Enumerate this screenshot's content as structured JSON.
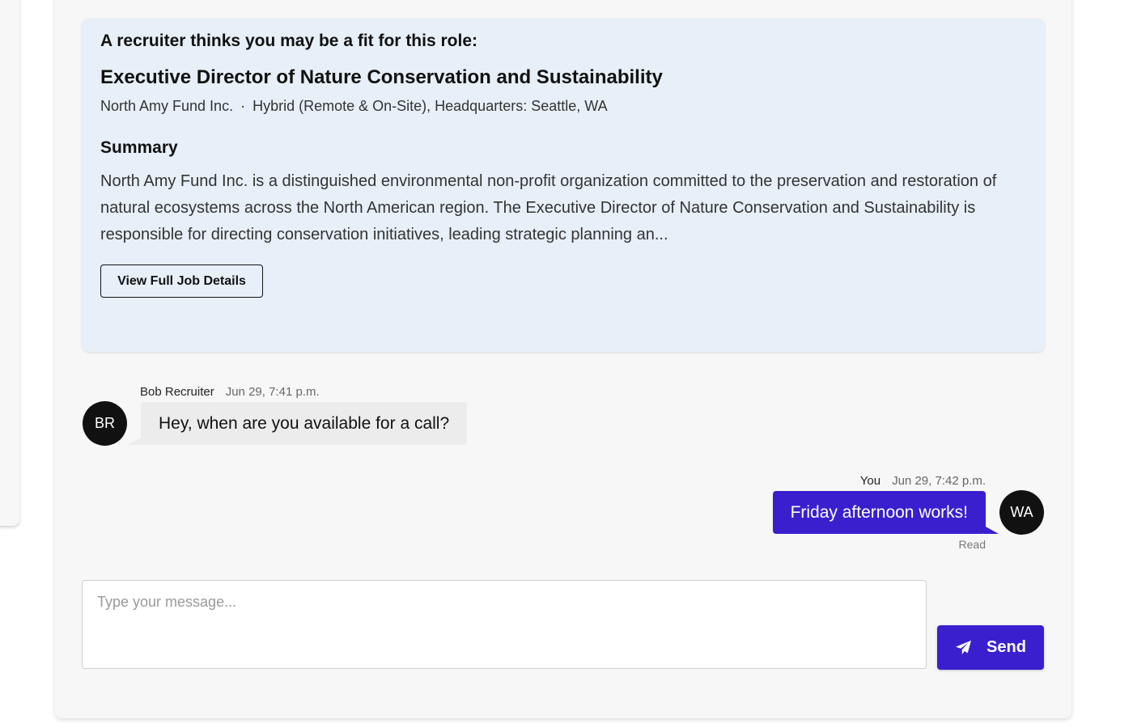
{
  "job_card": {
    "intro": "A recruiter thinks you may be a fit for this role:",
    "title": "Executive Director of Nature Conservation and Sustainability",
    "company": "North Amy Fund Inc.",
    "separator": "·",
    "location": "Hybrid (Remote & On-Site), Headquarters: Seattle, WA",
    "summary_heading": "Summary",
    "summary_text": "North Amy Fund Inc. is a distinguished environmental non-profit organization committed to the preservation and restoration of natural ecosystems across the North American region. The Executive Director of Nature Conservation and Sustainability is responsible for directing conservation initiatives, leading strategic planning an...",
    "details_button": "View Full Job Details"
  },
  "messages": [
    {
      "sender": "Bob Recruiter",
      "time": "Jun 29, 7:41 p.m.",
      "initials": "BR",
      "text": "Hey, when are you available for a call?"
    },
    {
      "sender": "You",
      "time": "Jun 29, 7:42 p.m.",
      "initials": "WA",
      "text": "Friday afternoon works!",
      "status": "Read"
    }
  ],
  "composer": {
    "placeholder": "Type your message...",
    "value": "",
    "send_label": "Send",
    "send_icon": "paper-plane-icon"
  },
  "colors": {
    "accent": "#3a1fcf",
    "job_card_bg": "#e7f0f8",
    "avatar_bg": "#111111",
    "incoming_bubble": "#ececec"
  }
}
